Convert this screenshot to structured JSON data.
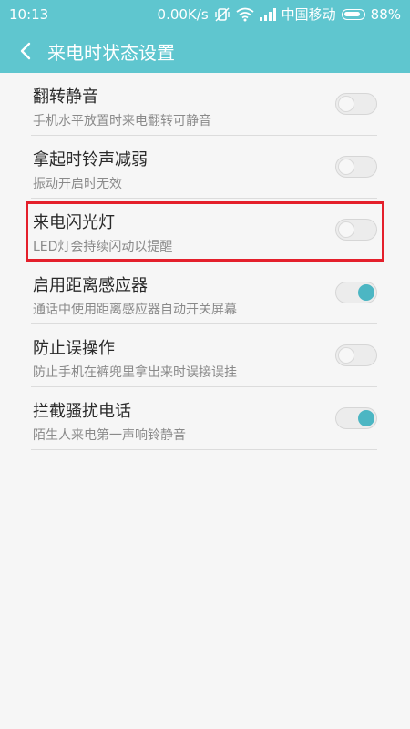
{
  "status_bar": {
    "time": "10:13",
    "network_speed": "0.00K/s",
    "carrier": "中国移动",
    "battery_text": "88%",
    "battery_level": 0.88,
    "icons": [
      "vibrate-icon",
      "wifi-icon",
      "signal-icon",
      "battery-icon"
    ]
  },
  "header": {
    "title": "来电时状态设置",
    "back_icon": "back-arrow-icon",
    "color": "#5fc6cf"
  },
  "settings": [
    {
      "title": "翻转静音",
      "description": "手机水平放置时来电翻转可静音",
      "enabled": false
    },
    {
      "title": "拿起时铃声减弱",
      "description": "振动开启时无效",
      "enabled": false
    },
    {
      "title": "来电闪光灯",
      "description": "LED灯会持续闪动以提醒",
      "enabled": false,
      "highlighted": true
    },
    {
      "title": "启用距离感应器",
      "description": "通话中使用距离感应器自动开关屏幕",
      "enabled": true
    },
    {
      "title": "防止误操作",
      "description": "防止手机在裤兜里拿出来时误接误挂",
      "enabled": false
    },
    {
      "title": "拦截骚扰电话",
      "description": "陌生人来电第一声响铃静音",
      "enabled": true
    }
  ],
  "colors": {
    "accent": "#4cb6c3",
    "highlight_border": "#e41f2b"
  }
}
